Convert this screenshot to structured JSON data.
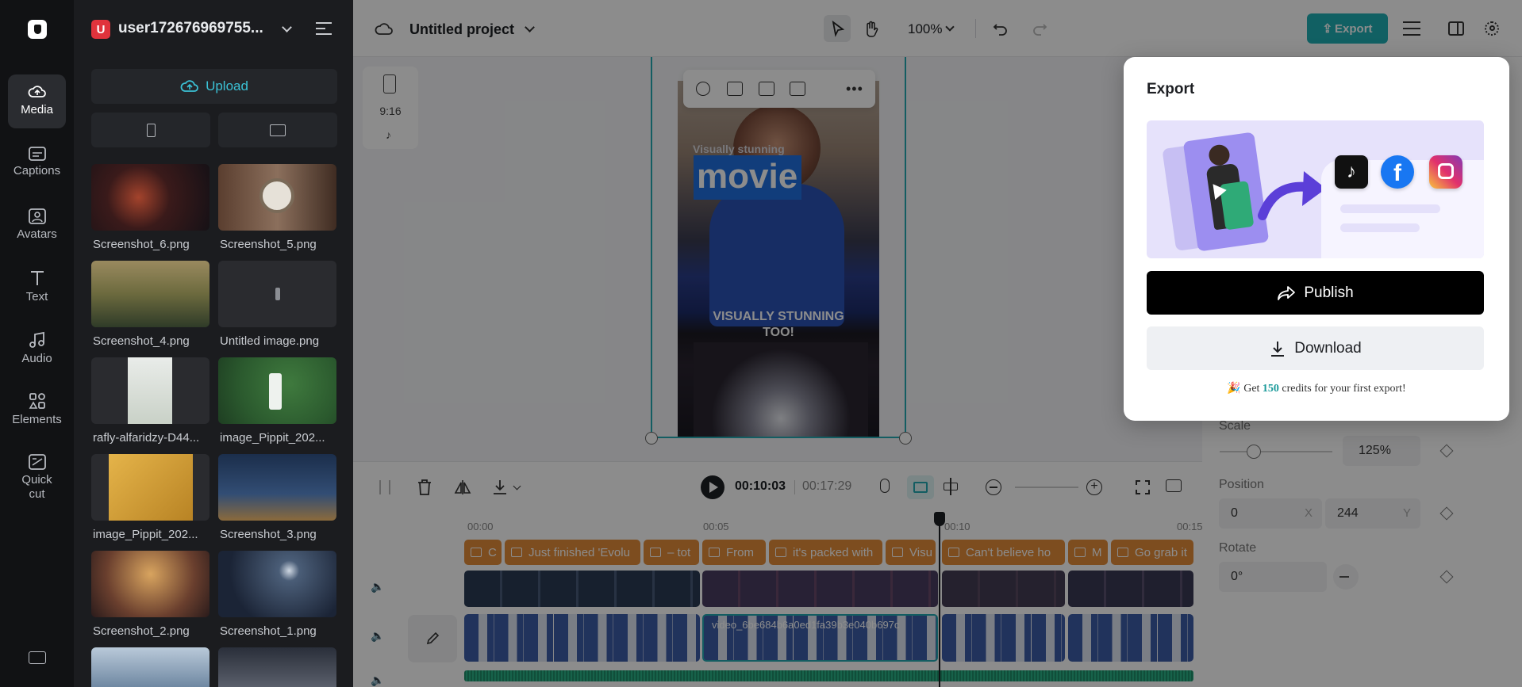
{
  "user": {
    "name": "user172676969755...",
    "avatar_letter": "U"
  },
  "rail": [
    {
      "label": "Media",
      "icon": "cloud-icon"
    },
    {
      "label": "Captions",
      "icon": "captions-icon"
    },
    {
      "label": "Avatars",
      "icon": "avatar-icon"
    },
    {
      "label": "Text",
      "icon": "text-icon"
    },
    {
      "label": "Audio",
      "icon": "music-icon"
    },
    {
      "label": "Elements",
      "icon": "elements-icon"
    },
    {
      "label": "Quick cut",
      "icon": "quickcut-icon"
    }
  ],
  "panel": {
    "upload_label": "Upload",
    "media": [
      {
        "name": "Screenshot_6.png"
      },
      {
        "name": "Screenshot_5.png"
      },
      {
        "name": "Screenshot_4.png"
      },
      {
        "name": "Untitled image.png"
      },
      {
        "name": "rafly-alfaridzy-D44..."
      },
      {
        "name": "image_Pippit_202..."
      },
      {
        "name": "image_Pippit_202..."
      },
      {
        "name": "Screenshot_3.png"
      },
      {
        "name": "Screenshot_2.png"
      },
      {
        "name": "Screenshot_1.png"
      }
    ]
  },
  "topbar": {
    "project_title": "Untitled project",
    "zoom": "100%",
    "export_label": "Export"
  },
  "canvas": {
    "ratio_label": "9:16",
    "overlay_small": "Visually stunning",
    "overlay_big": "movie",
    "caption": "VISUALLY STUNNING TOO!"
  },
  "timeline": {
    "current_time": "00:10:03",
    "total_time": "00:17:29",
    "ruler": [
      "00:00",
      "00:05",
      "00:10",
      "00:15"
    ],
    "text_clips": [
      "C",
      "Just finished 'Evolu",
      "– tot",
      "From",
      "it's packed with",
      "Visu",
      "Can't believe ho",
      "M",
      "Go grab it"
    ],
    "video_clip_name": "video_6be684b6a0ed1fa39b3e040b697c"
  },
  "props": {
    "scale_label": "Scale",
    "scale_value": "125%",
    "scale_fraction": 0.3,
    "position_label": "Position",
    "pos_x": "0",
    "pos_x_axis": "X",
    "pos_y": "244",
    "pos_y_axis": "Y",
    "rotate_label": "Rotate",
    "rotate_value": "0°"
  },
  "modal": {
    "title": "Export",
    "publish_label": "Publish",
    "download_label": "Download",
    "credits_pre": "Get",
    "credits_num": "150",
    "credits_post": "credits for your first export!",
    "social": [
      "tiktok-icon",
      "facebook-icon",
      "instagram-icon"
    ],
    "colors": {
      "accent": "#1a9a9a",
      "banner": "#e6e2fb",
      "arrow": "#5b3fd8"
    }
  }
}
